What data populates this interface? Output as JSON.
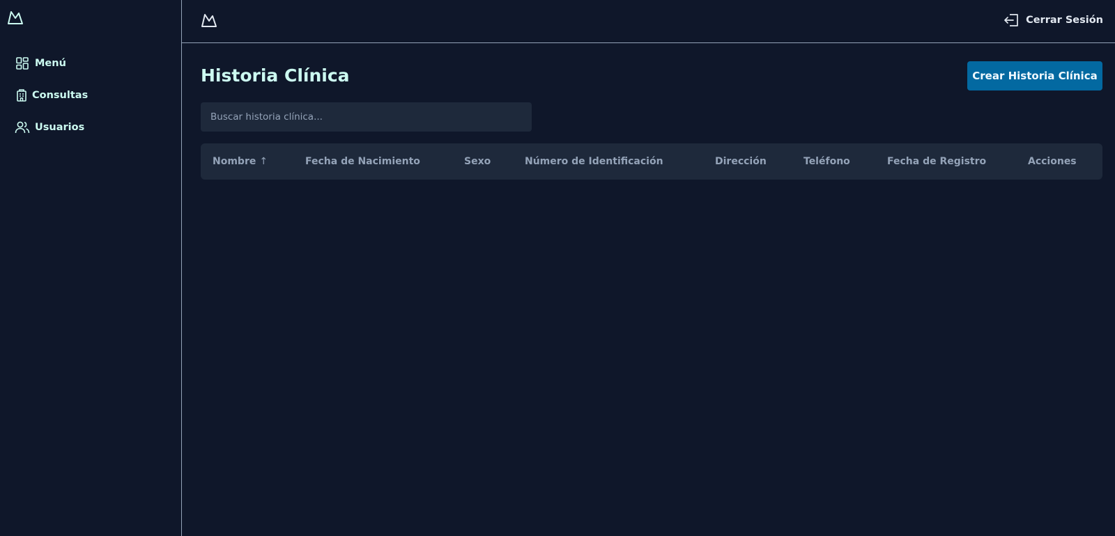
{
  "sidebar": {
    "logo_icon": "mountain-logo-icon",
    "items": [
      {
        "label": "Menú",
        "icon": "grid-icon"
      },
      {
        "label": "Consultas",
        "icon": "building-icon"
      },
      {
        "label": "Usuarios",
        "icon": "users-icon"
      }
    ]
  },
  "topbar": {
    "logo_icon": "mountain-logo-icon",
    "logout_label": "Cerrar Sesión",
    "logout_icon": "logout-icon"
  },
  "main": {
    "title": "Historia Clínica",
    "create_button_label": "Crear Historia Clínica",
    "search": {
      "placeholder": "Buscar historia clínica...",
      "value": ""
    },
    "table": {
      "columns": [
        {
          "label": "Nombre",
          "sort_indicator": "↑"
        },
        {
          "label": "Fecha de Nacimiento"
        },
        {
          "label": "Sexo"
        },
        {
          "label": "Número de Identificación"
        },
        {
          "label": "Dirección"
        },
        {
          "label": "Teléfono"
        },
        {
          "label": "Fecha de Registro"
        },
        {
          "label": "Acciones"
        }
      ],
      "rows": []
    }
  },
  "colors": {
    "background": "#0f172a",
    "panel": "#1e293b",
    "accent_button": "#0369a1",
    "title_text": "#ccfbf1",
    "muted_text": "#94a3b8"
  }
}
